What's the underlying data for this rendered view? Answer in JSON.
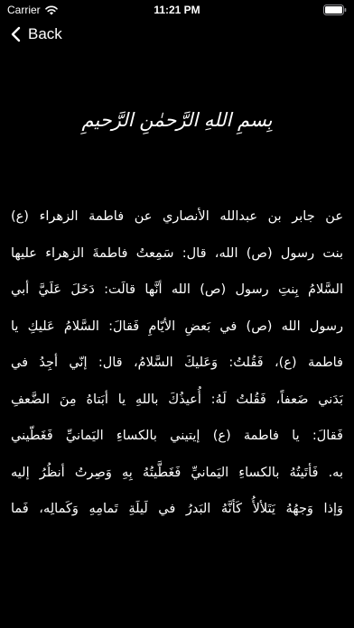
{
  "status_bar": {
    "carrier": "Carrier",
    "time": "11:21 PM",
    "wifi_icon": "wifi-icon",
    "battery_icon": "battery-full-icon"
  },
  "nav": {
    "back_label": "Back",
    "back_icon": "chevron-left-icon"
  },
  "content": {
    "basmala": "بِسمِ اللهِ الرَّحمٰنِ الرَّحيمِ",
    "lines": [
      "عن جابر بن عبدالله الأنصاري عن فاطمة الزهراء (ع)",
      "بنت رسول (ص) الله، قال: سَمِعتُ فاطمةَ الزهراء عليها",
      "السَّلامُ بِنتِ رسول (ص) الله أنَّها قالَت: دَخَلَ عَلَيَّ أبي",
      "رسول الله (ص) في بَعضِ الأيّامِ فَقالَ: السَّلامُ عَليكِ يا",
      "فاطمة (ع)، فَقُلتُ: وَعَليكَ السَّلامُ، قال: إنّي أجِدُ في",
      "بَدَني ضَعفاً، فَقُلتُ لَهُ: أُعيذُكَ باللهِ يا أبَتاهُ مِنَ الضَّعفِ",
      "فَقالَ: يا فاطمة (ع) إيتيني بالكساءِ اليَمانيِّ فَغَطّيني",
      "به. فَأتَيتُهُ بالكساءِ اليَمانيِّ فَغَطَّيتُهُ بِهِ وَصِرتُ أنظُرُ إليه",
      "وَإذا وَجهُهُ يَتَلألأُ كَأنَّهُ البَدرُ في لَيلَةِ تَمامِهِ وَكَمالِه، فَما"
    ]
  }
}
